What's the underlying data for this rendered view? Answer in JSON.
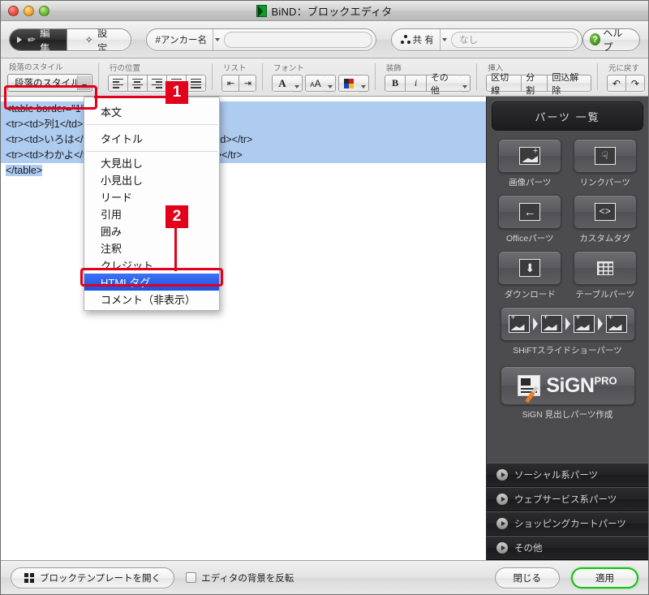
{
  "window": {
    "title": "BiND：ブロックエディタ",
    "traffic_lights": [
      "close",
      "minimize",
      "zoom"
    ]
  },
  "modebar": {
    "edit_tab": "編集",
    "settings_tab": "設定",
    "anchor_label": "#アンカー名",
    "anchor_value": "",
    "anchor_placeholder": "",
    "share_label": "共 有",
    "share_value": "なし",
    "help_label": "ヘルプ"
  },
  "toolbar": {
    "groups": [
      {
        "caption": "段落のスタイル"
      },
      {
        "caption": "行の位置"
      },
      {
        "caption": "リスト"
      },
      {
        "caption": "フォント"
      },
      {
        "caption": "装飾"
      },
      {
        "caption": "挿入"
      },
      {
        "caption": "元に戻す"
      }
    ],
    "style_button_label": "段落のスタイル",
    "decoration": {
      "bold": "B",
      "italic": "i",
      "other": "その他"
    },
    "insert": {
      "rule": "区切線",
      "split": "分割",
      "clear": "回込解除"
    }
  },
  "annotations": [
    {
      "number": "1",
      "target": "paragraph-style-button"
    },
    {
      "number": "2",
      "target": "html-tag-menu-item"
    }
  ],
  "menu": {
    "items": [
      {
        "label": "本文",
        "selected": false,
        "sep_after": true
      },
      {
        "label": "タイトル",
        "selected": false,
        "sep_after": true
      },
      {
        "label": "大見出し",
        "selected": false
      },
      {
        "label": "小見出し",
        "selected": false
      },
      {
        "label": "リード",
        "selected": false
      },
      {
        "label": "引用",
        "selected": false
      },
      {
        "label": "囲み",
        "selected": false
      },
      {
        "label": "注釈",
        "selected": false
      },
      {
        "label": "クレジット",
        "selected": false
      },
      {
        "label": "HTMLタグ",
        "selected": true
      },
      {
        "label": "コメント（非表示）",
        "selected": false
      }
    ]
  },
  "editor": {
    "lines": [
      "<table border=\"1\">",
      "<tr><td>列1</td><td>列2</td></tr>",
      "<tr><td>いろは</td><td>にほへとちりぬるを</td></tr>",
      "<tr><td>わかよ</td><td>たれそつねならむ</td></tr>",
      "</table>"
    ],
    "selection_color": "#aecbf0"
  },
  "parts_panel": {
    "header": "パーツ 一覧",
    "items": [
      {
        "label": "画像パーツ",
        "icon": "image-icon"
      },
      {
        "label": "リンクパーツ",
        "icon": "hand-pointer-icon"
      },
      {
        "label": "Officeパーツ",
        "icon": "arrow-left-icon"
      },
      {
        "label": "カスタムタグ",
        "icon": "code-brackets-icon"
      },
      {
        "label": "ダウンロード",
        "icon": "download-icon"
      },
      {
        "label": "テーブルパーツ",
        "icon": "table-grid-icon"
      }
    ],
    "slideshow": {
      "label": "SHiFTスライドショーパーツ",
      "icon": "slideshow-icon"
    },
    "sign": {
      "label": "SiGN 見出しパーツ作成",
      "word": "SiGN",
      "sup": "PRO"
    },
    "accordions": [
      {
        "label": "ソーシャル系パーツ"
      },
      {
        "label": "ウェブサービス系パーツ"
      },
      {
        "label": "ショッピングカートパーツ"
      },
      {
        "label": "その他"
      }
    ]
  },
  "bottombar": {
    "template_button": "ブロックテンプレートを開く",
    "invert_checkbox": "エディタの背景を反転",
    "invert_checked": false,
    "close_button": "閉じる",
    "apply_button": "適用"
  },
  "colors": {
    "annotation_red": "#e2001a",
    "menu_selected_blue": "#2a5ae8",
    "selection_blue": "#aecbf0",
    "panel_dark": "#4c4c4e",
    "apply_green": "#15c215"
  }
}
